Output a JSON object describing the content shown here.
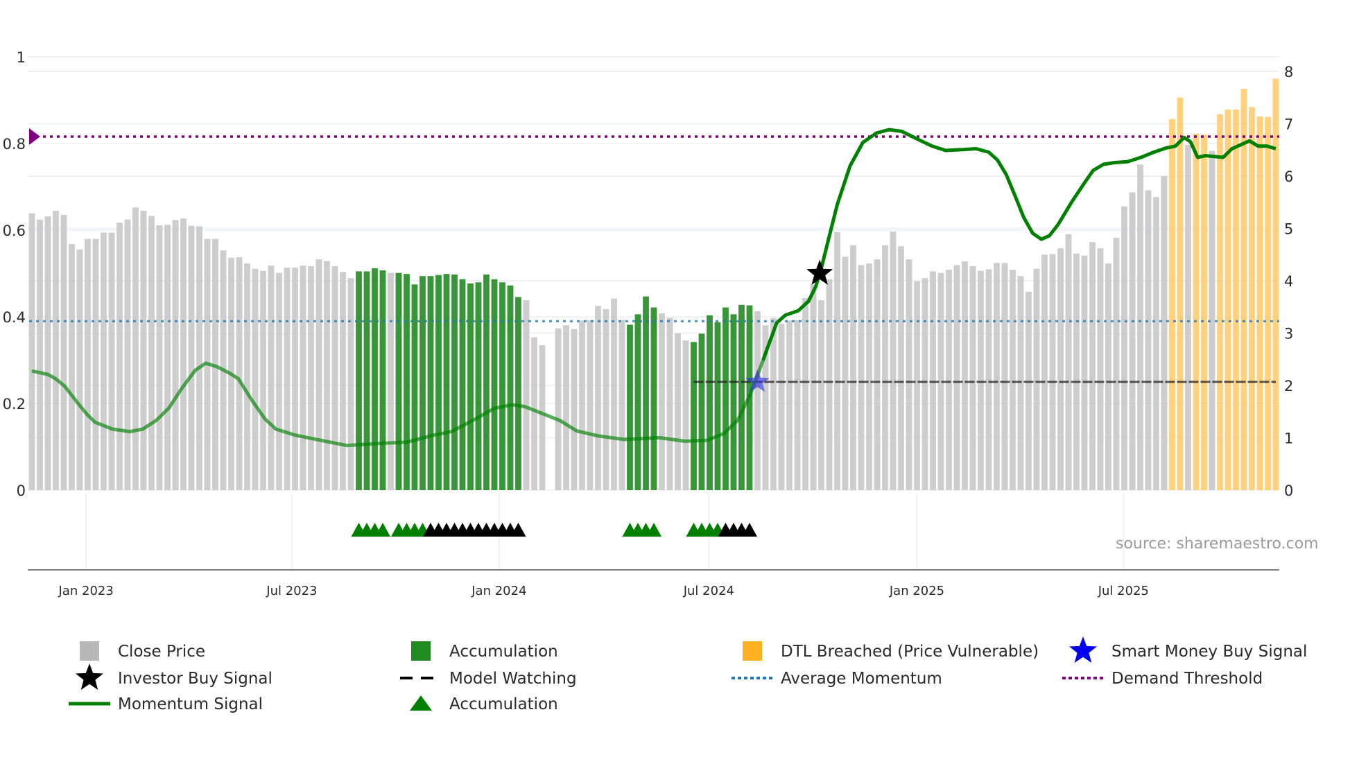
{
  "chart_data": {
    "type": "bar",
    "x_unit": "week index",
    "left_axis": {
      "ylim": [
        0,
        1
      ],
      "ticks": [
        "0",
        "0.2",
        "0.4",
        "0.6",
        "0.8",
        "1"
      ],
      "tick_values": [
        0,
        0.2,
        0.4,
        0.6,
        0.8,
        1
      ]
    },
    "right_axis": {
      "ylim": [
        0,
        8
      ],
      "ticks": [
        "0",
        "1",
        "2",
        "3",
        "4",
        "5",
        "6",
        "7",
        "8"
      ],
      "tick_values": [
        0,
        1,
        2,
        3,
        4,
        5,
        6,
        7,
        8
      ]
    },
    "x_ticks": [
      {
        "label": "Jan 2023",
        "x": 6.8
      },
      {
        "label": "Jul 2023",
        "x": 32.6
      },
      {
        "label": "Jan 2024",
        "x": 58.6
      },
      {
        "label": "Jul 2024",
        "x": 84.9
      },
      {
        "label": "Jan 2025",
        "x": 111.0
      },
      {
        "label": "Jul 2025",
        "x": 136.9
      }
    ],
    "grid": true,
    "source": "source: sharemaestro.com",
    "colors": {
      "normal": "#c8c8c8",
      "accumulation": "#228b22",
      "dtl": "#ffc966",
      "momentum": "#008000",
      "avg": "#1f77b4",
      "threshold": "#800080",
      "watching": "#222222",
      "smart": "#3333dd",
      "investor": "#000000"
    },
    "close_price": {
      "values": [
        5.29,
        5.17,
        5.23,
        5.34,
        5.26,
        4.7,
        4.6,
        4.8,
        4.8,
        4.92,
        4.92,
        5.11,
        5.17,
        5.4,
        5.34,
        5.24,
        5.06,
        5.07,
        5.16,
        5.19,
        5.05,
        5.04,
        4.8,
        4.8,
        4.58,
        4.44,
        4.45,
        4.33,
        4.23,
        4.19,
        4.29,
        4.15,
        4.25,
        4.25,
        4.29,
        4.28,
        4.41,
        4.38,
        4.28,
        4.17,
        4.05,
        4.18,
        4.18,
        4.24,
        4.2,
        4.15,
        4.15,
        4.13,
        3.93,
        4.09,
        4.09,
        4.11,
        4.13,
        4.12,
        4.03,
        3.95,
        3.97,
        4.12,
        4.03,
        3.97,
        3.91,
        3.69,
        3.63,
        2.92,
        2.77,
        null,
        3.09,
        3.15,
        3.08,
        3.24,
        3.25,
        3.52,
        3.46,
        3.66,
        3.25,
        3.16,
        3.36,
        3.7,
        3.49,
        3.38,
        3.29,
        3.0,
        2.86,
        2.83,
        2.99,
        3.34,
        3.21,
        3.49,
        3.36,
        3.54,
        3.53,
        3.42,
        3.15,
        3.29,
        3.18,
        3.24,
        3.25,
        3.67,
        3.93,
        3.63,
        4.03,
        4.93,
        4.46,
        4.68,
        4.3,
        4.33,
        4.41,
        4.68,
        4.94,
        4.66,
        4.41,
        3.99,
        4.05,
        4.18,
        4.15,
        4.21,
        4.3,
        4.37,
        4.28,
        4.19,
        4.22,
        4.34,
        4.34,
        4.21,
        4.09,
        3.79,
        4.23,
        4.5,
        4.51,
        4.62,
        4.89,
        4.52,
        4.48,
        4.74,
        4.62,
        4.33,
        4.82,
        5.42,
        5.69,
        6.22,
        5.73,
        5.6,
        6.0,
        7.09,
        7.5,
        6.6,
        6.81,
        6.79,
        6.48,
        7.18,
        7.27,
        7.27,
        7.67,
        7.32,
        7.14,
        7.13,
        7.86
      ],
      "state": "0-40:n,41-44:a,45:n,46-61:a,62-74:n,75-78:a,79-82:n,83-90:a,91-142:n,143-144:d,145:n,146-147:d,148:n,149-156:d"
    },
    "momentum": [
      [
        0,
        0.275
      ],
      [
        2,
        0.267
      ],
      [
        3,
        0.257
      ],
      [
        4.1,
        0.24
      ],
      [
        5.8,
        0.2
      ],
      [
        6.9,
        0.175
      ],
      [
        7.9,
        0.157
      ],
      [
        10.1,
        0.141
      ],
      [
        12.3,
        0.135
      ],
      [
        13.9,
        0.141
      ],
      [
        15.6,
        0.161
      ],
      [
        17.2,
        0.19
      ],
      [
        18.8,
        0.235
      ],
      [
        20.5,
        0.277
      ],
      [
        21.8,
        0.293
      ],
      [
        23.2,
        0.285
      ],
      [
        24.8,
        0.27
      ],
      [
        25.9,
        0.257
      ],
      [
        27.5,
        0.21
      ],
      [
        29.2,
        0.165
      ],
      [
        30.6,
        0.141
      ],
      [
        33,
        0.127
      ],
      [
        36.2,
        0.115
      ],
      [
        39.5,
        0.103
      ],
      [
        42.8,
        0.107
      ],
      [
        47.1,
        0.111
      ],
      [
        50.4,
        0.127
      ],
      [
        52.6,
        0.135
      ],
      [
        55.3,
        0.161
      ],
      [
        58,
        0.189
      ],
      [
        60.2,
        0.197
      ],
      [
        61.8,
        0.193
      ],
      [
        64,
        0.177
      ],
      [
        66.2,
        0.161
      ],
      [
        68.3,
        0.137
      ],
      [
        71.1,
        0.125
      ],
      [
        74.3,
        0.117
      ],
      [
        78.7,
        0.121
      ],
      [
        81.9,
        0.113
      ],
      [
        84.7,
        0.115
      ],
      [
        86.8,
        0.131
      ],
      [
        88.5,
        0.161
      ],
      [
        90.1,
        0.221
      ],
      [
        91.7,
        0.3
      ],
      [
        93.4,
        0.386
      ],
      [
        94.5,
        0.404
      ],
      [
        96.1,
        0.414
      ],
      [
        97.4,
        0.436
      ],
      [
        98.3,
        0.47
      ],
      [
        99.1,
        0.519
      ],
      [
        99.9,
        0.579
      ],
      [
        101,
        0.659
      ],
      [
        102.6,
        0.748
      ],
      [
        104.2,
        0.802
      ],
      [
        105.9,
        0.824
      ],
      [
        107.5,
        0.832
      ],
      [
        109.1,
        0.828
      ],
      [
        111.3,
        0.808
      ],
      [
        112.9,
        0.794
      ],
      [
        114.6,
        0.784
      ],
      [
        116.8,
        0.786
      ],
      [
        118.4,
        0.788
      ],
      [
        120,
        0.78
      ],
      [
        121.1,
        0.762
      ],
      [
        122.2,
        0.728
      ],
      [
        123.3,
        0.679
      ],
      [
        124.4,
        0.629
      ],
      [
        125.5,
        0.593
      ],
      [
        126.6,
        0.579
      ],
      [
        127.6,
        0.587
      ],
      [
        128.7,
        0.613
      ],
      [
        130.4,
        0.665
      ],
      [
        132,
        0.709
      ],
      [
        133.1,
        0.738
      ],
      [
        134.4,
        0.752
      ],
      [
        135.8,
        0.756
      ],
      [
        137.4,
        0.758
      ],
      [
        139.1,
        0.768
      ],
      [
        140.7,
        0.78
      ],
      [
        142.3,
        0.79
      ],
      [
        143.4,
        0.794
      ],
      [
        144.5,
        0.814
      ],
      [
        145.3,
        0.804
      ],
      [
        146.2,
        0.768
      ],
      [
        147.2,
        0.772
      ],
      [
        149.4,
        0.768
      ],
      [
        150.5,
        0.788
      ],
      [
        152.7,
        0.806
      ],
      [
        153.8,
        0.794
      ],
      [
        154.9,
        0.794
      ],
      [
        156,
        0.788
      ]
    ],
    "average_momentum": 0.39,
    "demand_threshold": 0.816,
    "model_watching": {
      "from": 83,
      "to": 156,
      "value": 0.25
    },
    "smart_money_buy": [
      {
        "x": 91,
        "value": 0.25
      }
    ],
    "investor_buy": [
      {
        "x": 98.8,
        "value": 0.5
      }
    ],
    "accumulation_markers": {
      "green": [
        41,
        42,
        43,
        44,
        46,
        47,
        48,
        49,
        75,
        76,
        77,
        78,
        83,
        84,
        85,
        86
      ],
      "black": [
        50,
        51,
        52,
        53,
        54,
        55,
        56,
        57,
        58,
        59,
        60,
        61,
        87,
        88,
        89,
        90
      ]
    },
    "legend": [
      {
        "label": "Close Price",
        "icon": "gray-square-icon"
      },
      {
        "label": "Accumulation",
        "icon": "green-square-icon"
      },
      {
        "label": "DTL Breached (Price Vulnerable)",
        "icon": "orange-square-icon"
      },
      {
        "label": "Smart Money Buy Signal",
        "icon": "blue-star-icon"
      },
      {
        "label": "Investor Buy Signal",
        "icon": "black-star-icon"
      },
      {
        "label": "Model Watching",
        "icon": "black-dash-icon"
      },
      {
        "label": "Average Momentum",
        "icon": "blue-dot-line-icon"
      },
      {
        "label": "Demand Threshold",
        "icon": "purple-dot-line-icon"
      },
      {
        "label": "Momentum Signal",
        "icon": "green-line-icon"
      },
      {
        "label": "Accumulation",
        "icon": "green-triangle-icon"
      }
    ]
  }
}
